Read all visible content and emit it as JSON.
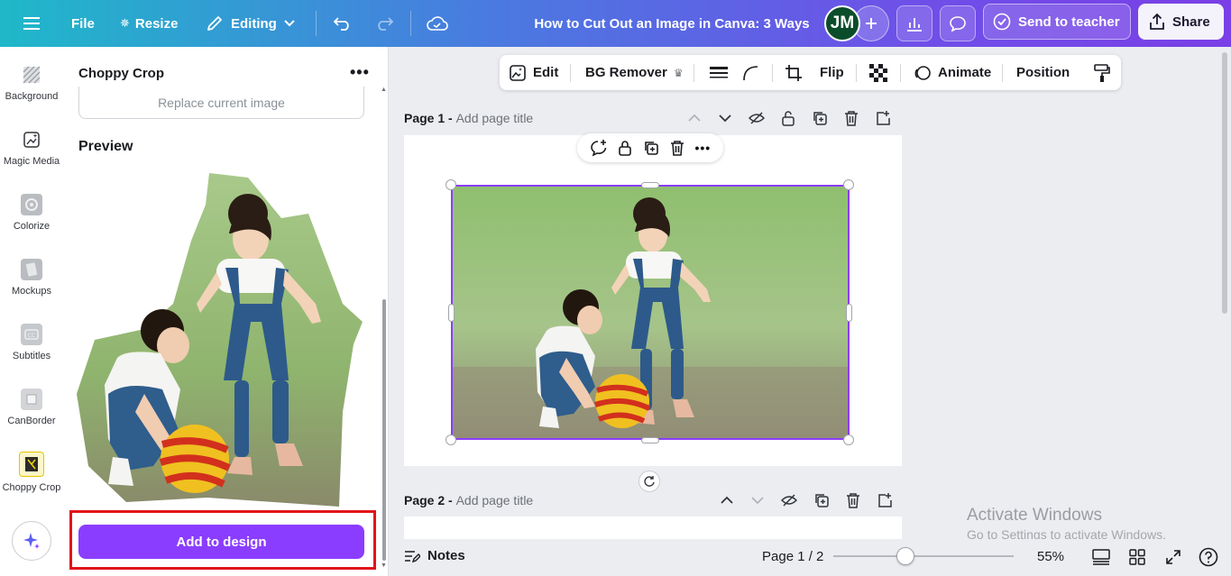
{
  "topbar": {
    "file": "File",
    "resize": "Resize",
    "editing": "Editing",
    "doc_title": "How to Cut Out an Image in Canva: 3 Ways",
    "avatar_initials": "JM",
    "send_to_teacher": "Send to teacher",
    "share": "Share"
  },
  "rail": {
    "items": [
      {
        "label": "Background",
        "icon": "background-pattern-icon"
      },
      {
        "label": "Magic Media",
        "icon": "magic-media-icon"
      },
      {
        "label": "Colorize",
        "icon": "colorize-icon"
      },
      {
        "label": "Mockups",
        "icon": "mockups-icon"
      },
      {
        "label": "Subtitles",
        "icon": "subtitles-icon"
      },
      {
        "label": "CanBorder",
        "icon": "canborder-icon"
      },
      {
        "label": "Choppy Crop",
        "icon": "choppy-crop-icon"
      }
    ]
  },
  "panel": {
    "title": "Choppy Crop",
    "replace_label": "Replace current image",
    "preview_label": "Preview",
    "add_button": "Add to design"
  },
  "floating_toolbar": {
    "edit": "Edit",
    "bg_remover": "BG Remover",
    "flip": "Flip",
    "animate": "Animate",
    "position": "Position"
  },
  "pages": [
    {
      "label": "Page 1 -",
      "title_placeholder": "Add page title"
    },
    {
      "label": "Page 2 -",
      "title_placeholder": "Add page title"
    }
  ],
  "bottombar": {
    "notes": "Notes",
    "page_count": "Page 1 / 2",
    "zoom": "55%",
    "zoom_fraction": 0.4
  },
  "watermark": {
    "line1": "Activate Windows",
    "line2": "Go to Settings to activate Windows."
  },
  "colors": {
    "accent": "#8b3dff",
    "highlight": "#e2141a",
    "avatar_bg": "#0b4d2a"
  }
}
